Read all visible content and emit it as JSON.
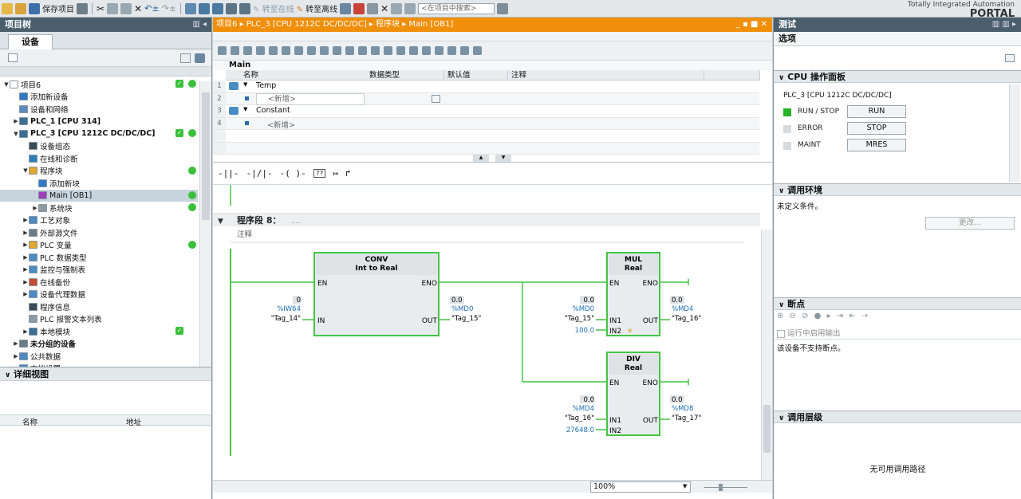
{
  "toolbar": {
    "save_project": "保存项目",
    "go_online": "转至在线",
    "go_offline": "转至离线",
    "search_placeholder": "<在项目中搜索>"
  },
  "brand": {
    "line1": "Totally Integrated Automation",
    "line2": "PORTAL"
  },
  "project_tree": {
    "title": "项目树",
    "devices_tab": "设备",
    "items": [
      {
        "label": "项目6",
        "level": 0,
        "arrow": "▼",
        "icon_color": "#ffffff",
        "status": "okdot"
      },
      {
        "label": "添加新设备",
        "level": 1,
        "arrow": "",
        "icon_color": "#2e79c7",
        "status": ""
      },
      {
        "label": "设备和网络",
        "level": 1,
        "arrow": "",
        "icon_color": "#5a8ac2",
        "status": ""
      },
      {
        "label": "PLC_1 [CPU 314]",
        "level": 1,
        "arrow": "▶",
        "icon_color": "#3a6e94",
        "status": "",
        "bold": true
      },
      {
        "label": "PLC_3 [CPU 1212C DC/DC/DC]",
        "level": 1,
        "arrow": "▼",
        "icon_color": "#3a6e94",
        "status": "okdot",
        "bold": true
      },
      {
        "label": "设备组态",
        "level": 2,
        "arrow": "",
        "icon_color": "#3b4b57",
        "status": ""
      },
      {
        "label": "在线和诊断",
        "level": 2,
        "arrow": "",
        "icon_color": "#2f7fb8",
        "status": ""
      },
      {
        "label": "程序块",
        "level": 2,
        "arrow": "▼",
        "icon_color": "#e0a630",
        "status": "dot"
      },
      {
        "label": "添加新块",
        "level": 3,
        "arrow": "",
        "icon_color": "#2e79c7",
        "status": ""
      },
      {
        "label": "Main [OB1]",
        "level": 3,
        "arrow": "",
        "icon_color": "#9c3fb8",
        "status": "dot",
        "selected": true
      },
      {
        "label": "系统块",
        "level": 3,
        "arrow": "▶",
        "icon_color": "#8e9aa3",
        "status": "dot"
      },
      {
        "label": "工艺对象",
        "level": 2,
        "arrow": "▶",
        "icon_color": "#4d8bc4",
        "status": ""
      },
      {
        "label": "外部源文件",
        "level": 2,
        "arrow": "▶",
        "icon_color": "#6b7b86",
        "status": ""
      },
      {
        "label": "PLC 变量",
        "level": 2,
        "arrow": "▶",
        "icon_color": "#e0a630",
        "status": "dot"
      },
      {
        "label": "PLC 数据类型",
        "level": 2,
        "arrow": "▶",
        "icon_color": "#4d8bc4",
        "status": ""
      },
      {
        "label": "监控与强制表",
        "level": 2,
        "arrow": "▶",
        "icon_color": "#4d8bc4",
        "status": ""
      },
      {
        "label": "在线备份",
        "level": 2,
        "arrow": "▶",
        "icon_color": "#c84b3a",
        "status": ""
      },
      {
        "label": "设备代理数据",
        "level": 2,
        "arrow": "▶",
        "icon_color": "#4d8bc4",
        "status": ""
      },
      {
        "label": "程序信息",
        "level": 2,
        "arrow": "",
        "icon_color": "#3b4b57",
        "status": ""
      },
      {
        "label": "PLC 报警文本列表",
        "level": 2,
        "arrow": "",
        "icon_color": "#8e9aa3",
        "status": ""
      },
      {
        "label": "本地模块",
        "level": 2,
        "arrow": "▶",
        "icon_color": "#3a6e94",
        "status": "ok"
      },
      {
        "label": "未分组的设备",
        "level": 1,
        "arrow": "▶",
        "icon_color": "#6b7b86",
        "status": "",
        "bold": true
      },
      {
        "label": "公共数据",
        "level": 1,
        "arrow": "▶",
        "icon_color": "#4d8bc4",
        "status": ""
      },
      {
        "label": "文档设置",
        "level": 1,
        "arrow": "▶",
        "icon_color": "#4d8bc4",
        "status": ""
      }
    ]
  },
  "detail_view": {
    "title": "详细视图",
    "col_name": "名称",
    "col_address": "地址"
  },
  "editor": {
    "breadcrumb": [
      "项目6",
      "PLC_3 [CPU 1212C DC/DC/DC]",
      "程序块",
      "Main [OB1]"
    ],
    "block_name": "Main",
    "interface": {
      "headers": [
        "名称",
        "数据类型",
        "默认值",
        "注释"
      ],
      "rows": [
        {
          "num": "1",
          "name": "Temp"
        },
        {
          "num": "2",
          "name": "<新增>"
        },
        {
          "num": "3",
          "name": "Constant"
        },
        {
          "num": "4",
          "name": "<新增>"
        }
      ]
    },
    "lad_tools": [
      "-||-",
      "-|/|-",
      "-( )-",
      "??",
      "↦",
      "↱"
    ],
    "network": {
      "title": "程序段 8：",
      "subtitle": ".....",
      "comment": "注释"
    },
    "conv": {
      "name": "CONV",
      "sub": "Int to Real",
      "en": "EN",
      "eno": "ENO",
      "in_label": "IN",
      "out_label": "OUT",
      "in_val": "0",
      "in_addr": "%IW64",
      "in_tag": "\"Tag_14\"",
      "out_val": "0.0",
      "out_addr": "%MD0",
      "out_tag": "\"Tag_15\""
    },
    "mul": {
      "name": "MUL",
      "sub": "Real",
      "en": "EN",
      "eno": "ENO",
      "in1_label": "IN1",
      "in2_label": "IN2",
      "out_label": "OUT",
      "in1_val": "0.0",
      "in1_addr": "%MD0",
      "in1_tag": "\"Tag_15\"",
      "in2_val": "100.0",
      "out_val": "0.0",
      "out_addr": "%MD4",
      "out_tag": "\"Tag_16\""
    },
    "div": {
      "name": "DIV",
      "sub": "Real",
      "en": "EN",
      "eno": "ENO",
      "in1_label": "IN1",
      "in2_label": "IN2",
      "out_label": "OUT",
      "in1_val": "0.0",
      "in1_addr": "%MD4",
      "in1_tag": "\"Tag_16\"",
      "in2_val": "27648.0",
      "out_val": "0.0",
      "out_addr": "%MD8",
      "out_tag": "\"Tag_17\""
    },
    "zoom": "100%"
  },
  "test_panel": {
    "title": "测试",
    "options": "选项",
    "cpu_panel": {
      "title": "CPU 操作面板",
      "device": "PLC_3 [CPU 1212C DC/DC/DC]",
      "rows": [
        {
          "label": "RUN / STOP",
          "button": "RUN",
          "led": "#25b325"
        },
        {
          "label": "ERROR",
          "button": "STOP",
          "led": "#d7dbde"
        },
        {
          "label": "MAINT",
          "button": "MRES",
          "led": "#d7dbde"
        }
      ]
    },
    "call_env": {
      "title": "调用环境",
      "text": "未定义条件。",
      "change_button": "更改..."
    },
    "breakpoints": {
      "title": "断点",
      "checkbox": "运行中启用输出",
      "text": "该设备不支持断点。"
    },
    "call_hierarchy": {
      "title": "调用层级",
      "text": "无可用调用路径"
    }
  },
  "colors": {
    "accent_orange": "#f08f0a",
    "header_dark": "#4a5e6c",
    "box_green": "#44c444"
  }
}
